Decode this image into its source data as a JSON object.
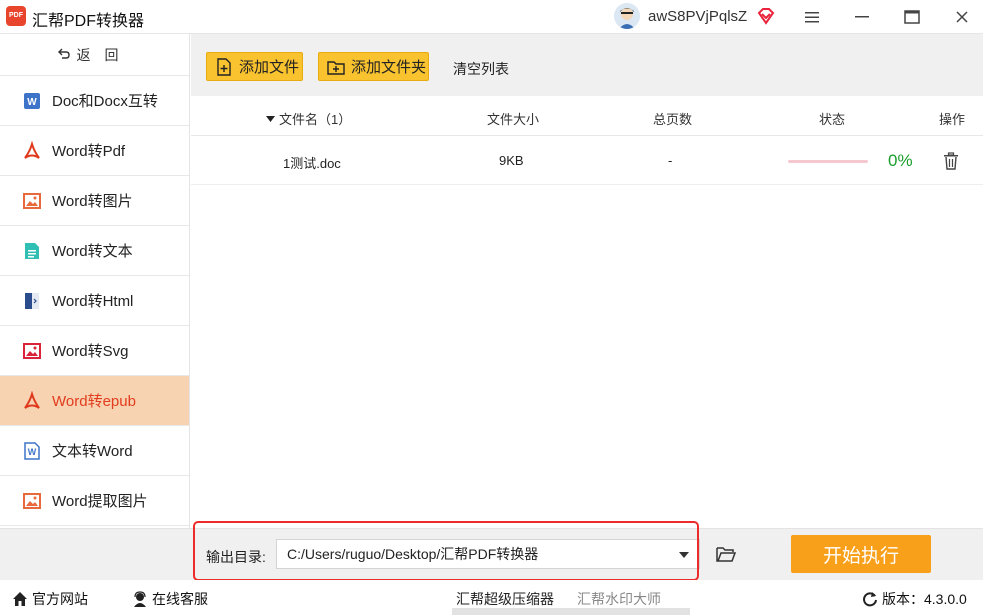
{
  "window": {
    "app_title": "汇帮PDF转换器",
    "logo_text": "PDF",
    "user_name": "awS8PVjPqlsZ"
  },
  "sidebar": {
    "back_icon": "back-arrow-icon",
    "back_label": "返回",
    "items": [
      {
        "label": "Doc和Docx互转",
        "icon": "word-doc-icon",
        "active": false
      },
      {
        "label": "Word转Pdf",
        "icon": "pdf-icon",
        "active": false
      },
      {
        "label": "Word转图片",
        "icon": "image-icon",
        "active": false
      },
      {
        "label": "Word转文本",
        "icon": "text-file-icon",
        "active": false
      },
      {
        "label": "Word转Html",
        "icon": "html-file-icon",
        "active": false
      },
      {
        "label": "Word转Svg",
        "icon": "image-icon",
        "active": false
      },
      {
        "label": "Word转epub",
        "icon": "pdf-icon",
        "active": true
      },
      {
        "label": "文本转Word",
        "icon": "word-doc-icon",
        "active": false
      },
      {
        "label": "Word提取图片",
        "icon": "image-icon",
        "active": false
      }
    ]
  },
  "toolbar": {
    "add_file_label": "添加文件",
    "add_folder_label": "添加文件夹",
    "clear_list_label": "清空列表"
  },
  "table": {
    "headers": {
      "name": "文件名（1）",
      "size": "文件大小",
      "pages": "总页数",
      "status": "状态",
      "action": "操作"
    },
    "rows": [
      {
        "name": "1测试.doc",
        "size": "9KB",
        "pages": "-",
        "progress": 0,
        "progress_text": "0%"
      }
    ]
  },
  "output": {
    "label": "输出目录:",
    "path": "C:/Users/ruguo/Desktop/汇帮PDF转换器",
    "start_label": "开始执行"
  },
  "statusbar": {
    "website_label": "官方网站",
    "support_label": "在线客服",
    "link1_label": "汇帮超级压缩器",
    "link2_label": "汇帮水印大师",
    "version_label": "版本：4.3.0.0"
  },
  "colors": {
    "accent_yellow": "#f9c22f",
    "start_orange": "#f9a01b",
    "active_bg": "#f8d3b1",
    "active_text": "#e23b1e",
    "progress_green": "#1a9e2a",
    "highlight_red": "#ee2b2b"
  }
}
